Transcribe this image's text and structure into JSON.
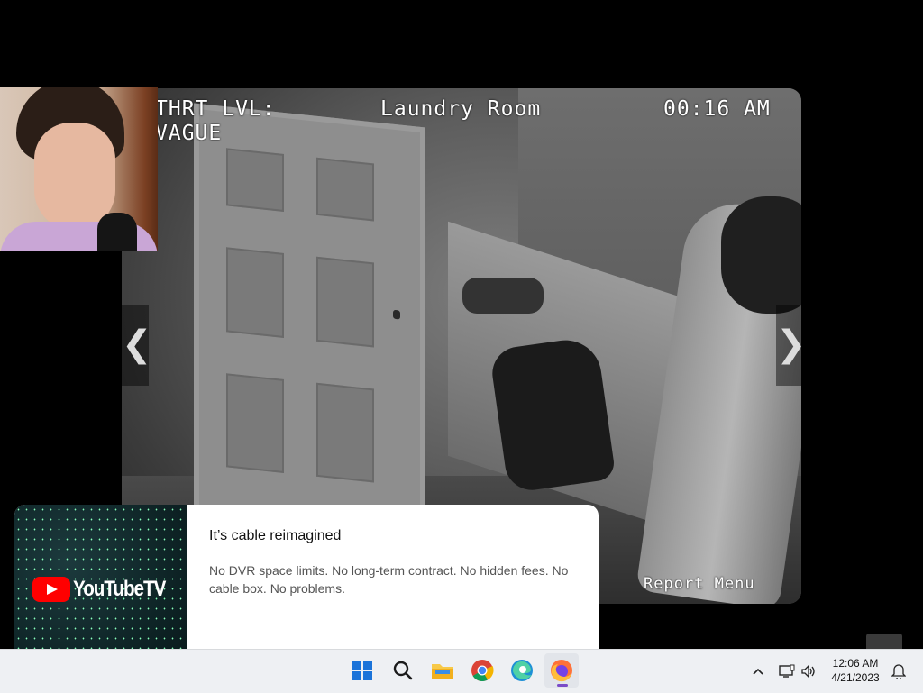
{
  "camera": {
    "threat_label": "THRT LVL:",
    "threat_value": "VAGUE",
    "room": "Laundry Room",
    "time": "00:16 AM",
    "report_menu": "Report Menu",
    "prev_arrow": "❮",
    "next_arrow": "❯"
  },
  "ad": {
    "brand": "YouTubeTV",
    "title": "It’s cable reimagined",
    "description": "No DVR space limits. No long-term contract. No hidden fees. No cable box. No problems."
  },
  "taskbar": {
    "apps": [
      {
        "name": "start",
        "icon": "windows-icon"
      },
      {
        "name": "search",
        "icon": "search-icon"
      },
      {
        "name": "file-explorer",
        "icon": "folder-icon"
      },
      {
        "name": "chrome",
        "icon": "chrome-icon"
      },
      {
        "name": "edge",
        "icon": "edge-icon"
      },
      {
        "name": "firefox",
        "icon": "firefox-icon",
        "active": true
      }
    ],
    "clock_time": "12:06 AM",
    "clock_date": "4/21/2023"
  },
  "colors": {
    "accent_active": "#7a4cc8",
    "youtube_red": "#ff0000",
    "windows_blue": "#1a73d9"
  }
}
